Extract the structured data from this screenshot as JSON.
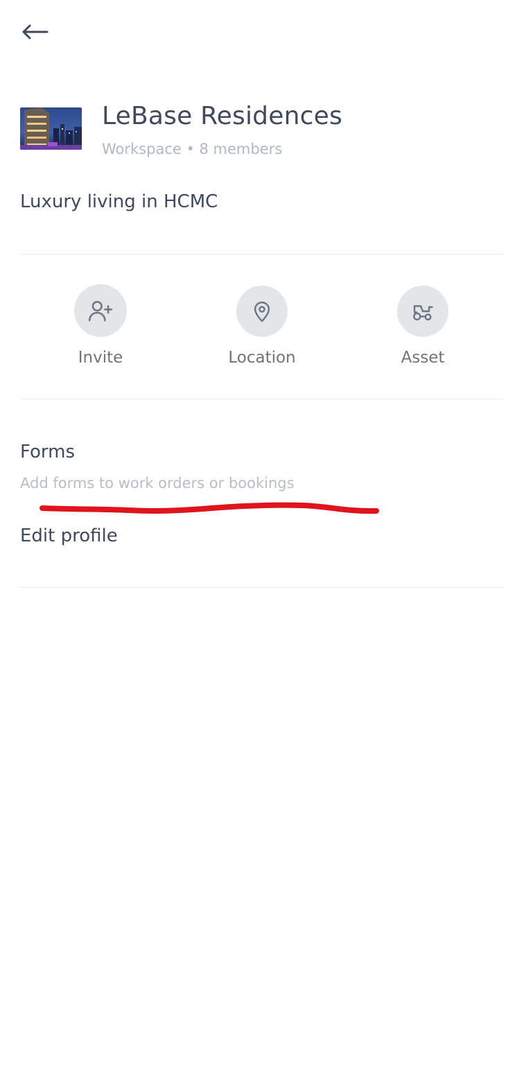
{
  "header": {
    "title": "LeBase Residences",
    "subtitle": "Workspace • 8 members",
    "thumbnail_icon": "building-photo"
  },
  "description": "Luxury living in HCMC",
  "actions": [
    {
      "label": "Invite",
      "icon": "add-user-icon"
    },
    {
      "label": "Location",
      "icon": "map-pin-icon"
    },
    {
      "label": "Asset",
      "icon": "tractor-icon"
    }
  ],
  "forms": {
    "title": "Forms",
    "subtitle": "Add forms to work orders or bookings"
  },
  "edit_profile": {
    "label": "Edit profile"
  },
  "colors": {
    "text_primary": "#3f4a5c",
    "text_secondary": "#b1b7c3",
    "icon_bg": "#e3e5e7",
    "annotation": "#e0141c"
  }
}
